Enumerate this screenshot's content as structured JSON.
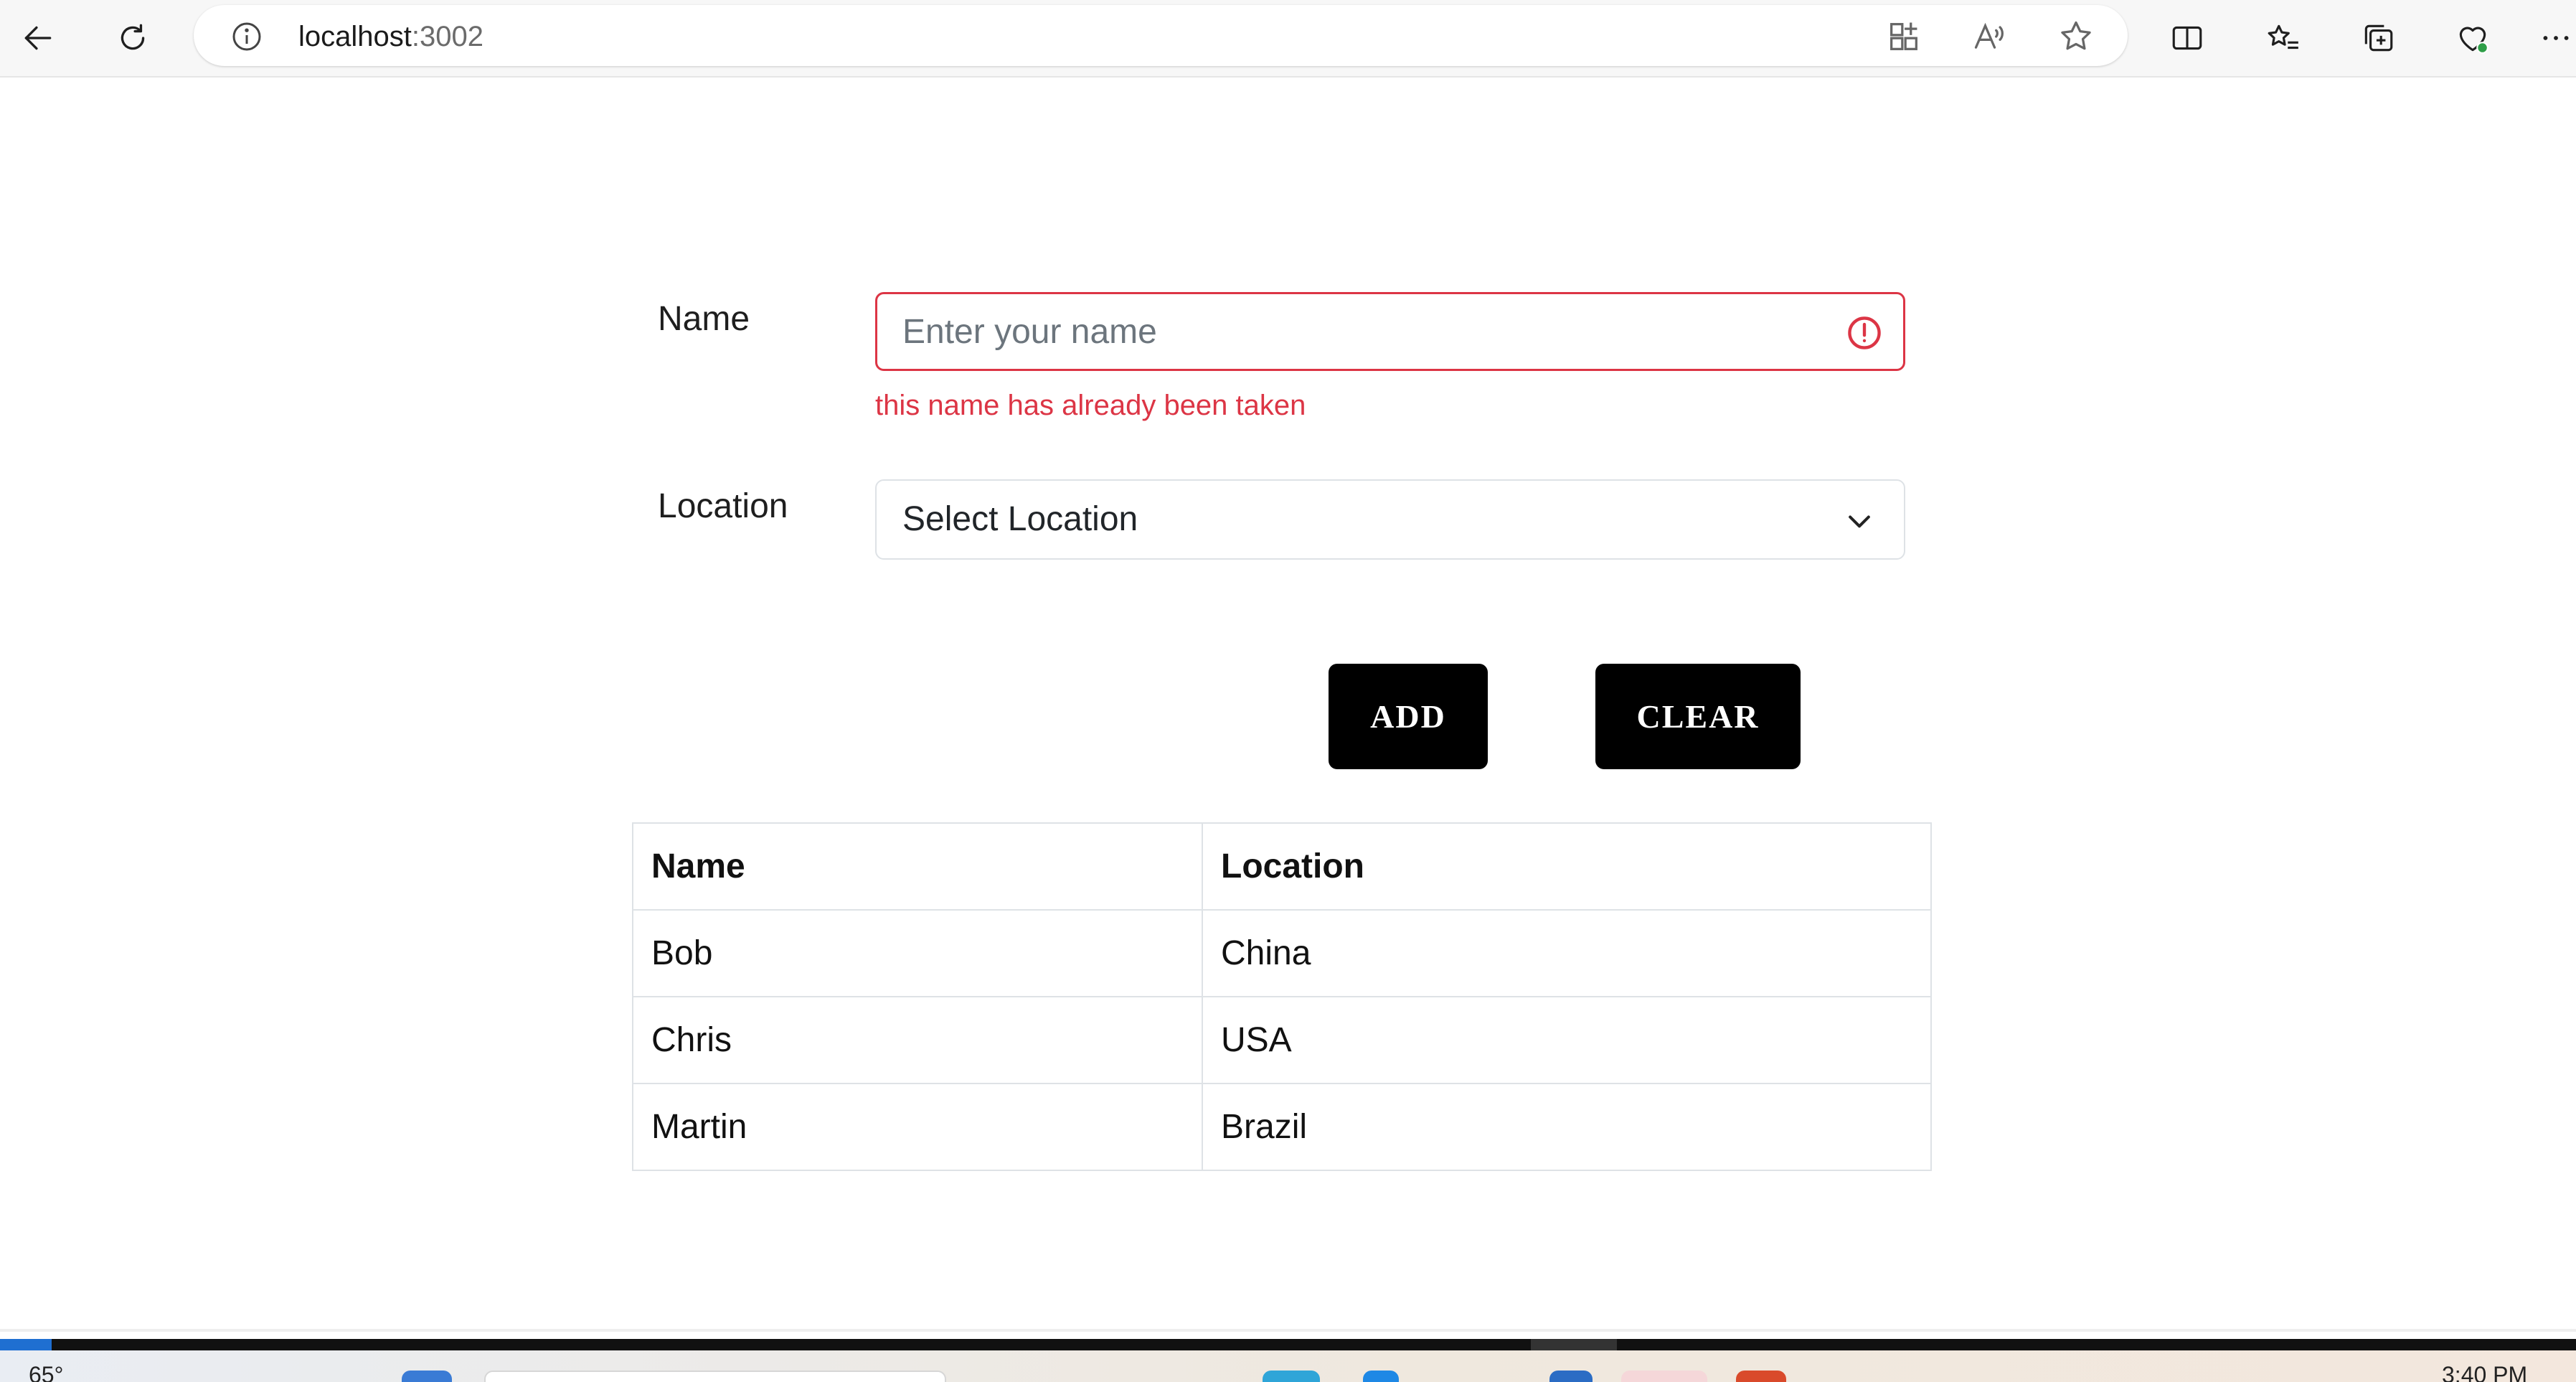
{
  "browser": {
    "url_host": "localhost",
    "url_port": ":3002"
  },
  "form": {
    "name_label": "Name",
    "name_placeholder": "Enter your name",
    "name_value": "",
    "name_error": "this name has already been taken",
    "location_label": "Location",
    "location_selected": "Select Location"
  },
  "buttons": {
    "add_label": "ADD",
    "clear_label": "CLEAR"
  },
  "table": {
    "headers": [
      "Name",
      "Location"
    ],
    "rows": [
      [
        "Bob",
        "China"
      ],
      [
        "Chris",
        "USA"
      ],
      [
        "Martin",
        "Brazil"
      ]
    ]
  },
  "taskbar": {
    "weather": "65°",
    "clock": "3:40 PM"
  },
  "colors": {
    "error": "#dc3545",
    "button_bg": "#000000",
    "button_text": "#ffffff",
    "border": "#dee2e6"
  },
  "icons": {
    "toolbar_left": [
      "back-arrow-icon",
      "refresh-icon"
    ],
    "address_bar": [
      "info-icon",
      "app-grid-icon",
      "read-aloud-icon",
      "favorite-star-icon"
    ],
    "toolbar_right": [
      "split-screen-icon",
      "favorites-list-icon",
      "collections-icon",
      "browser-essentials-icon",
      "more-menu-icon"
    ],
    "form": [
      "alert-circle-icon",
      "chevron-down-icon"
    ]
  }
}
